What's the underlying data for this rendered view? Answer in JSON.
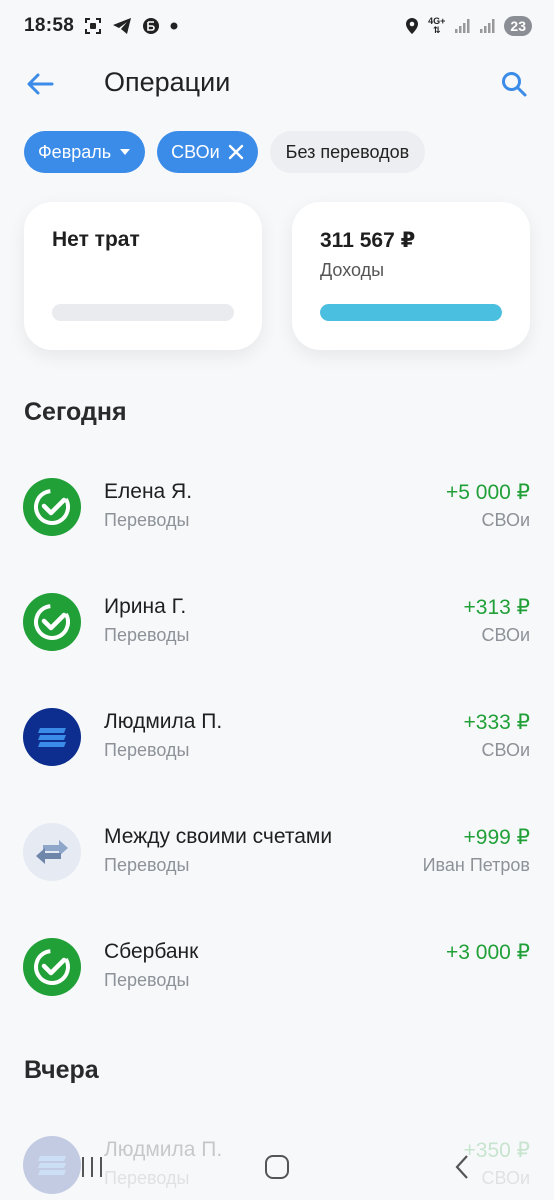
{
  "status": {
    "time": "18:58",
    "net_label": "4G+",
    "battery": "23"
  },
  "header": {
    "title": "Операции"
  },
  "filters": {
    "month": "Февраль",
    "account": "СВОи",
    "no_transfers": "Без переводов"
  },
  "summary": {
    "expenses_label": "Нет трат",
    "income_amount": "311 567 ₽",
    "income_label": "Доходы",
    "income_progress": 1.0
  },
  "sections": {
    "today": "Сегодня",
    "yesterday": "Вчера"
  },
  "transactions": [
    {
      "name": "Елена Я.",
      "category": "Переводы",
      "amount": "+5 000 ₽",
      "account": "СВОи",
      "icon": "sber-check-icon"
    },
    {
      "name": "Ирина Г.",
      "category": "Переводы",
      "amount": "+313 ₽",
      "account": "СВОи",
      "icon": "sber-check-icon"
    },
    {
      "name": "Людмила П.",
      "category": "Переводы",
      "amount": "+333 ₽",
      "account": "СВОи",
      "icon": "bank-stripes-icon"
    },
    {
      "name": "Между своими счетами",
      "category": "Переводы",
      "amount": "+999 ₽",
      "account": "Иван Петров",
      "icon": "transfer-arrows-icon"
    },
    {
      "name": "Сбербанк",
      "category": "Переводы",
      "amount": "+3 000 ₽",
      "account": "",
      "icon": "sber-check-icon"
    }
  ],
  "yesterday_transactions": [
    {
      "name": "Людмила П.",
      "category": "Переводы",
      "amount": "+350 ₽",
      "account": "СВОи",
      "icon": "bank-stripes-icon"
    }
  ],
  "colors": {
    "accent": "#3b8be8",
    "income_green": "#21a038",
    "sber_green": "#21a038",
    "bank_blue": "#0d2e8f",
    "progress": "#4bbfdf"
  }
}
